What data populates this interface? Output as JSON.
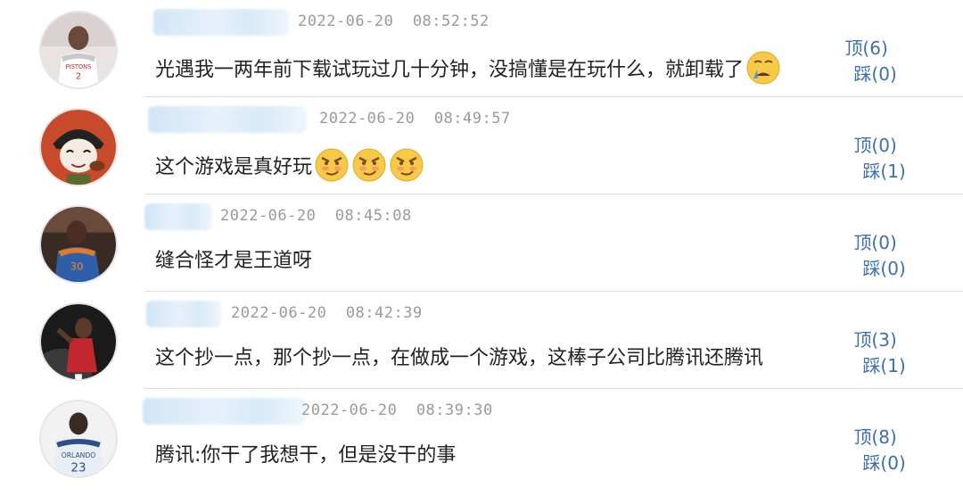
{
  "comments": [
    {
      "timestamp": "2022-06-20  08:52:52",
      "text": "光遇我一两年前下载试玩过几十分钟，没搞懂是在玩什么，就卸载了",
      "emojis": [
        "crying-emoji"
      ],
      "up_label": "顶(6)",
      "down_label": "踩(0)",
      "avatar": "basketball-player-white-jersey"
    },
    {
      "timestamp": "2022-06-20  08:49:57",
      "text": "这个游戏是真好玩",
      "emojis": [
        "smirk-emoji",
        "smirk-emoji",
        "smirk-emoji"
      ],
      "up_label": "顶(0)",
      "down_label": "踩(1)",
      "avatar": "cartoon-face-red"
    },
    {
      "timestamp": "2022-06-20  08:45:08",
      "text": "缝合怪才是王道呀",
      "emojis": [],
      "up_label": "顶(0)",
      "down_label": "踩(0)",
      "avatar": "basketball-player-blue-jersey"
    },
    {
      "timestamp": "2022-06-20  08:42:39",
      "text": "这个抄一点，那个抄一点，在做成一个游戏，这棒子公司比腾讯还腾讯",
      "emojis": [],
      "up_label": "顶(3)",
      "down_label": "踩(1)",
      "avatar": "basketball-action-red"
    },
    {
      "timestamp": "2022-06-20  08:39:30",
      "text": "腾讯:你干了我想干，但是没干的事",
      "emojis": [],
      "up_label": "顶(8)",
      "down_label": "踩(0)",
      "avatar": "basketball-player-jersey-23"
    }
  ],
  "colors": {
    "vote_link": "#3c6fb5",
    "timestamp": "#9a9a9a",
    "text": "#222222",
    "divider": "#dcdcdc"
  }
}
